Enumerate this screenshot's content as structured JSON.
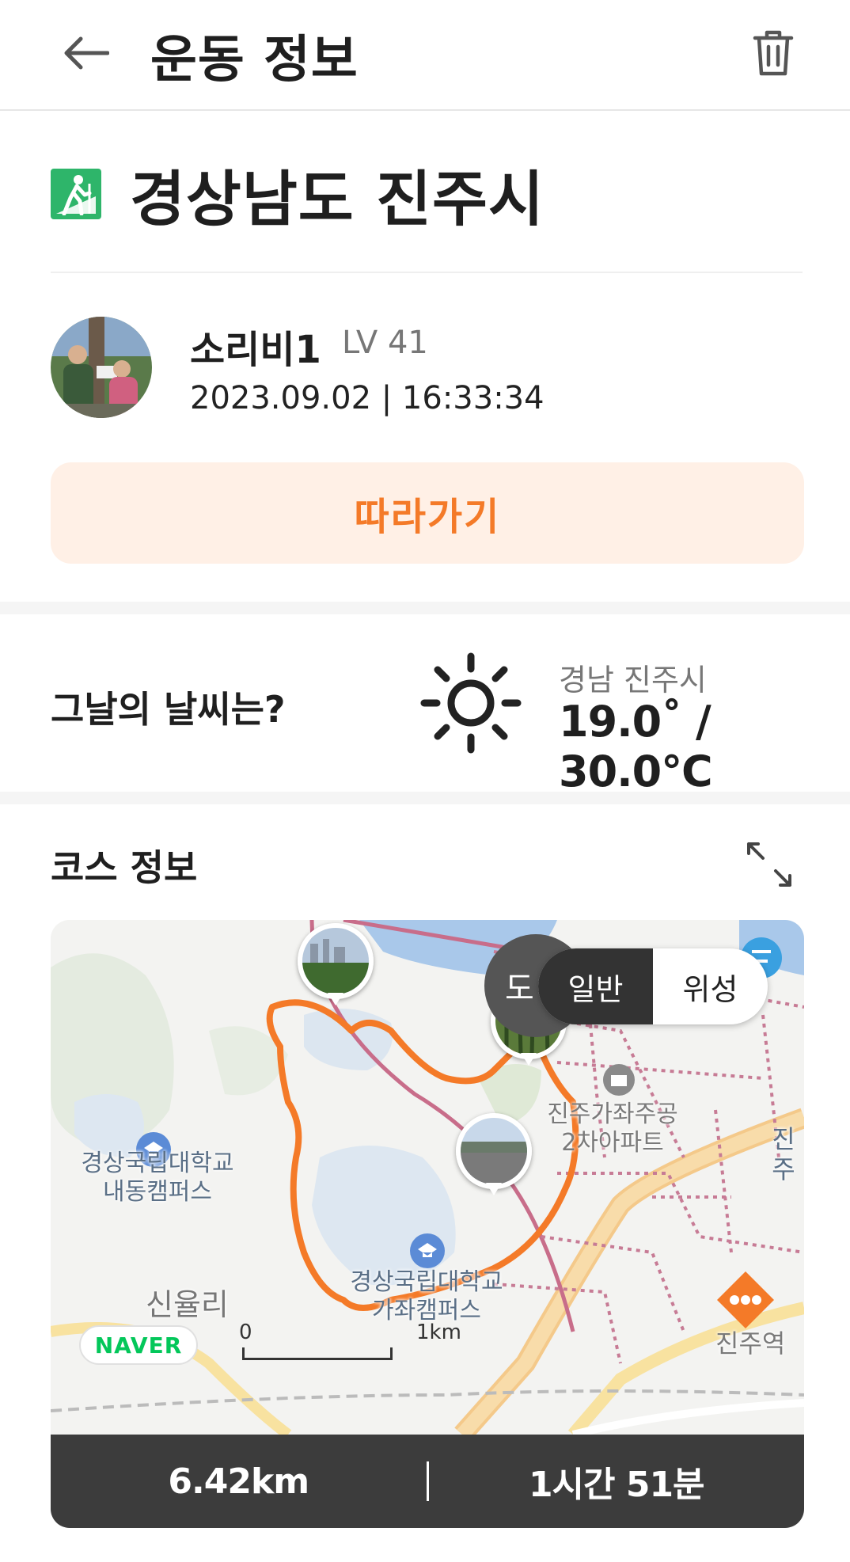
{
  "appbar": {
    "title": "운동 정보",
    "back_icon": "arrow-left-icon",
    "delete_icon": "trash-icon"
  },
  "activity": {
    "icon": "hiking-icon",
    "icon_color": "#2eb56a",
    "title": "경상남도 진주시"
  },
  "user": {
    "name": "소리비1",
    "level": "LV 41",
    "datetime": "2023.09.02 | 16:33:34"
  },
  "follow_button": {
    "label": "따라가기",
    "text_color": "#f47a28",
    "bg_color": "#fff0e6"
  },
  "weather": {
    "label": "그날의 날씨는?",
    "icon": "sun-icon",
    "region": "경남 진주시",
    "temperature": "19.0˚ / 30.0℃"
  },
  "course": {
    "title": "코스 정보",
    "expand_icon": "expand-icon",
    "map": {
      "toggle": {
        "options": [
          "일반",
          "위성"
        ],
        "selected": "일반"
      },
      "hidden_label": "도",
      "labels": {
        "campus1_line1": "경상국립대학교",
        "campus1_line2": "내동캠퍼스",
        "campus2_line1": "경상국립대학교",
        "campus2_line2": "가좌캠퍼스",
        "apt_line1": "진주가좌주공",
        "apt_line2": "2차아파트",
        "village": "신율리",
        "station": "진주역",
        "edge": "진주"
      },
      "logo": "NAVER",
      "scale": {
        "start": "0",
        "end": "1km"
      },
      "route_color": "#f47a28"
    },
    "stats": {
      "distance": "6.42km",
      "duration": "1시간 51분"
    }
  }
}
